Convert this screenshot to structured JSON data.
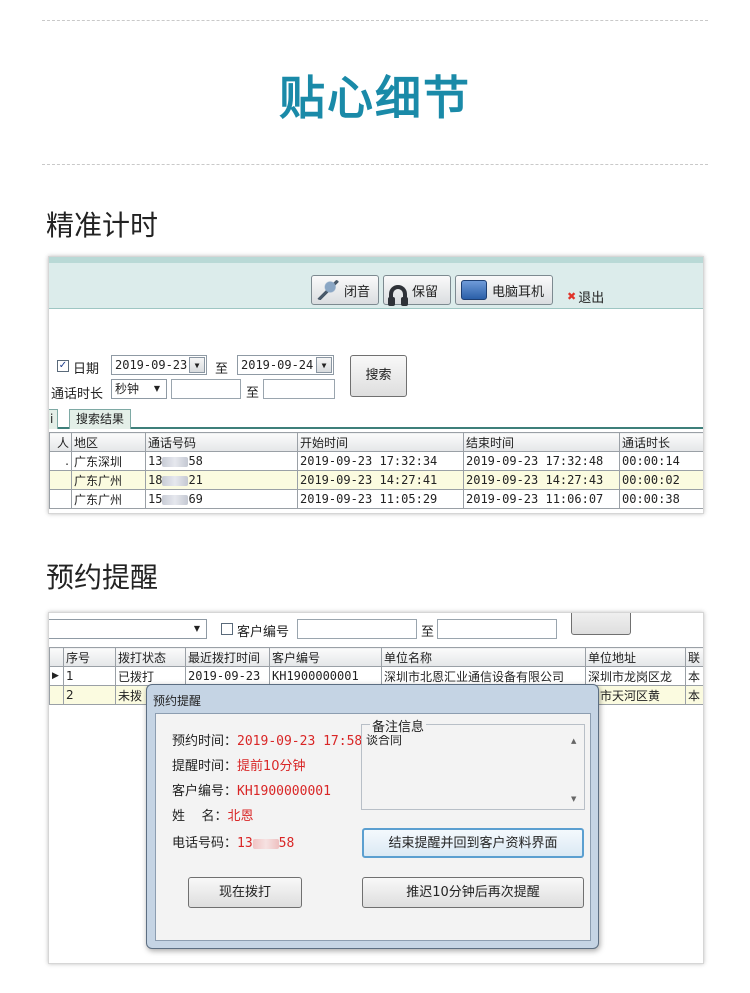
{
  "hero_title": "贴心细节",
  "sections": {
    "timing": "精准计时",
    "reminder": "预约提醒"
  },
  "toolbar": {
    "mute": "闭音",
    "hold": "保留",
    "pc_headset": "电脑耳机",
    "exit": "退出"
  },
  "search_form": {
    "date_label": "日期",
    "date_from": "2019-09-23",
    "to_1": "至",
    "date_to": "2019-09-24",
    "duration_label": "通话时长",
    "duration_unit": "秒钟",
    "to_2": "至",
    "search_button": "搜索"
  },
  "results": {
    "tab_left": "i",
    "tab_active": "搜索结果",
    "columns": [
      "人",
      "地区",
      "通话号码",
      "开始时间",
      "结束时间",
      "通话时长"
    ],
    "rows": [
      {
        "first": ".",
        "region": "广东深圳",
        "phone_a": "13",
        "phone_b": "58",
        "start": "2019-09-23 17:32:34",
        "end": "2019-09-23 17:32:48",
        "dur": "00:00:14"
      },
      {
        "first": "",
        "region": "广东广州",
        "phone_a": "18",
        "phone_b": "21",
        "start": "2019-09-23 14:27:41",
        "end": "2019-09-23 14:27:43",
        "dur": "00:00:02"
      },
      {
        "first": "",
        "region": "广东广州",
        "phone_a": "15",
        "phone_b": "69",
        "start": "2019-09-23 11:05:29",
        "end": "2019-09-23 11:06:07",
        "dur": "00:00:38"
      }
    ]
  },
  "customer_filter": {
    "customer_no_label": "客户编号",
    "to": "至"
  },
  "customer_grid": {
    "columns": [
      "序号",
      "拨打状态",
      "最近拨打时间",
      "客户编号",
      "单位名称",
      "单位地址",
      "联"
    ],
    "rows": [
      {
        "no": "1",
        "status": "已拨打",
        "last": "2019-09-23",
        "cust": "KH1900000001",
        "company": "深圳市北恩汇业通信设备有限公司",
        "addr": "深圳市龙岗区龙",
        "extra": "本"
      },
      {
        "no": "2",
        "status": "未拨",
        "last": "",
        "cust": "",
        "company": "",
        "addr": "州市天河区黄",
        "extra": "本"
      }
    ]
  },
  "reminder_dialog": {
    "title": "预约提醒",
    "appt_time_label": "预约时间：",
    "appt_time": "2019-09-23 17:58",
    "remind_label": "提醒时间：",
    "remind_value": "提前10分钟",
    "cust_no_label": "客户编号：",
    "cust_no": "KH1900000001",
    "name_label": "姓    名：",
    "name": "北恩",
    "phone_label": "电话号码：",
    "phone_a": "13",
    "phone_b": "58",
    "notes_legend": "备注信息",
    "notes": "谈合同",
    "end_button": "结束提醒并回到客户资料界面",
    "dial_button": "现在拨打",
    "snooze_button": "推迟10分钟后再次提醒"
  }
}
